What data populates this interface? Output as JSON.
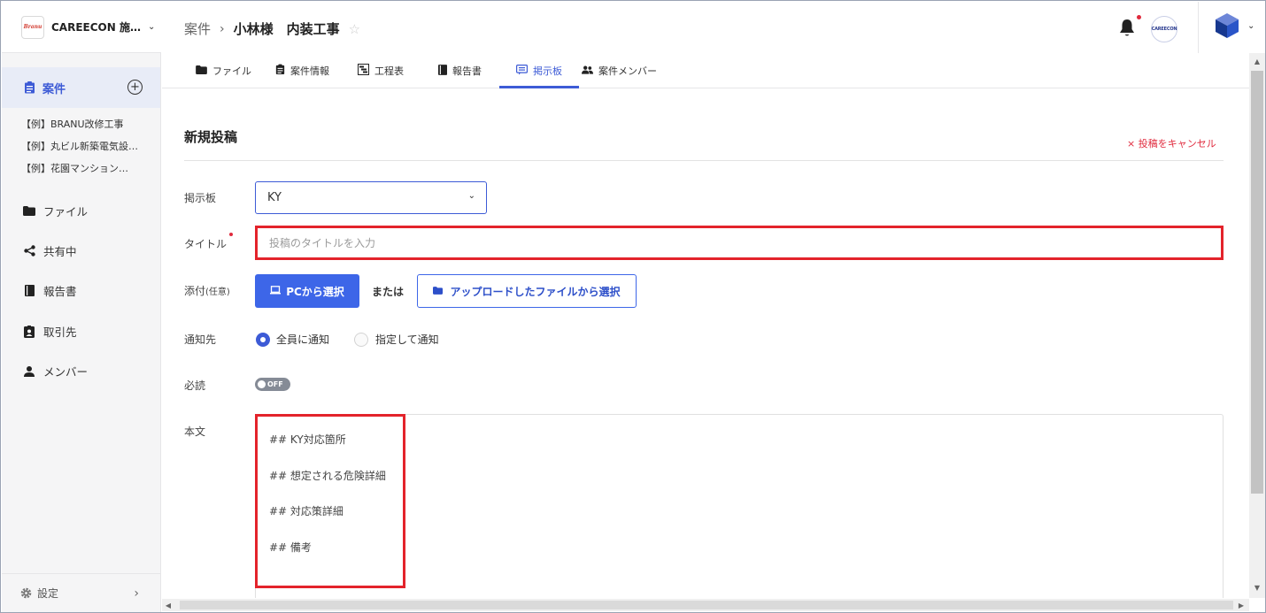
{
  "brand": {
    "logo_text": "Branu",
    "name": "CAREECON 施…",
    "caret": "⌄"
  },
  "sidebar": {
    "active_item": {
      "label": "案件",
      "add_symbol": "+"
    },
    "projects": [
      "【例】BRANU改修工事",
      "【例】丸ビル新築電気設…",
      "【例】花園マンション…"
    ],
    "items": [
      {
        "label": "ファイル",
        "icon": "folder-icon"
      },
      {
        "label": "共有中",
        "icon": "share-icon"
      },
      {
        "label": "報告書",
        "icon": "book-icon"
      },
      {
        "label": "取引先",
        "icon": "badge-icon"
      },
      {
        "label": "メンバー",
        "icon": "person-icon"
      }
    ],
    "settings": {
      "label": "設定",
      "chevron": "›"
    }
  },
  "header": {
    "breadcrumb_parent": "案件",
    "separator": "›",
    "breadcrumb_current": "小林様　内装工事",
    "star": "☆",
    "avatar_text": "CAREECON",
    "account_caret": "⌄"
  },
  "tabs": [
    {
      "label": "ファイル",
      "icon": "folder-icon",
      "active": false
    },
    {
      "label": "案件情報",
      "icon": "clipboard-icon",
      "active": false
    },
    {
      "label": "工程表",
      "icon": "gantt-icon",
      "active": false
    },
    {
      "label": "報告書",
      "icon": "book-icon",
      "active": false
    },
    {
      "label": "掲示板",
      "icon": "message-board-icon",
      "active": true
    },
    {
      "label": "案件メンバー",
      "icon": "group-icon",
      "active": false
    }
  ],
  "form": {
    "section_title": "新規投稿",
    "cancel_label": "× 投稿をキャンセル",
    "board_label": "掲示板",
    "board_value": "KY",
    "select_caret": "⌄",
    "title_label": "タイトル",
    "title_placeholder": "投稿のタイトルを入力",
    "attach_label": "添付",
    "attach_optional": "(任意)",
    "pc_button": "PCから選択",
    "or_text": "または",
    "upload_button": "アップロードしたファイルから選択",
    "notify_label": "通知先",
    "notify_all": "全員に通知",
    "notify_specific": "指定して通知",
    "must_read_label": "必読",
    "toggle_text": "OFF",
    "body_label": "本文",
    "body_lines": [
      "## KY対応箇所",
      "## 想定される危険詳細",
      "## 対応策詳細",
      "## 備考"
    ]
  },
  "colors": {
    "accent": "#3d5bd6",
    "highlight": "#e3232b",
    "cancel": "#e02a3d"
  }
}
